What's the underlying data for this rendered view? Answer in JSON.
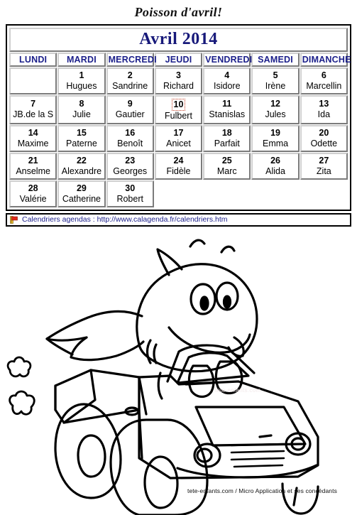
{
  "page": {
    "heading": "Poisson d'avril!"
  },
  "calendar": {
    "month_title": "Avril 2014",
    "weekdays": [
      "LUNDI",
      "MARDI",
      "MERCREDI",
      "JEUDI",
      "VENDREDI",
      "SAMEDI",
      "DIMANCHE"
    ],
    "selected_day": "10",
    "weeks": [
      [
        {
          "num": "",
          "name": ""
        },
        {
          "num": "1",
          "name": "Hugues"
        },
        {
          "num": "2",
          "name": "Sandrine"
        },
        {
          "num": "3",
          "name": "Richard"
        },
        {
          "num": "4",
          "name": "Isidore"
        },
        {
          "num": "5",
          "name": "Irène"
        },
        {
          "num": "6",
          "name": "Marcellin"
        }
      ],
      [
        {
          "num": "7",
          "name": "JB.de la S"
        },
        {
          "num": "8",
          "name": "Julie"
        },
        {
          "num": "9",
          "name": "Gautier"
        },
        {
          "num": "10",
          "name": "Fulbert"
        },
        {
          "num": "11",
          "name": "Stanislas"
        },
        {
          "num": "12",
          "name": "Jules"
        },
        {
          "num": "13",
          "name": "Ida"
        }
      ],
      [
        {
          "num": "14",
          "name": "Maxime"
        },
        {
          "num": "15",
          "name": "Paterne"
        },
        {
          "num": "16",
          "name": "Benoît"
        },
        {
          "num": "17",
          "name": "Anicet"
        },
        {
          "num": "18",
          "name": "Parfait"
        },
        {
          "num": "19",
          "name": "Emma"
        },
        {
          "num": "20",
          "name": "Odette"
        }
      ],
      [
        {
          "num": "21",
          "name": "Anselme"
        },
        {
          "num": "22",
          "name": "Alexandre"
        },
        {
          "num": "23",
          "name": "Georges"
        },
        {
          "num": "24",
          "name": "Fidèle"
        },
        {
          "num": "25",
          "name": "Marc"
        },
        {
          "num": "26",
          "name": "Alida"
        },
        {
          "num": "27",
          "name": "Zita"
        }
      ],
      [
        {
          "num": "28",
          "name": "Valérie"
        },
        {
          "num": "29",
          "name": "Catherine"
        },
        {
          "num": "30",
          "name": "Robert"
        },
        {
          "num": "",
          "name": ""
        },
        {
          "num": "",
          "name": ""
        },
        {
          "num": "",
          "name": ""
        },
        {
          "num": "",
          "name": ""
        }
      ]
    ]
  },
  "footer": {
    "icon": "flag-icon",
    "text": "Calendriers agendas : http://www.calagenda.fr/calendriers.htm"
  },
  "illustration": {
    "alt_name": "fish-driving-car-coloring-page",
    "watermark": "tete-enfants.com",
    "credit": "tete-enfants.com / Micro Application et ses concédants"
  },
  "colors": {
    "title_blue": "#17197a",
    "weekday_blue": "#1b1f8a",
    "selection_red": "#c23b22",
    "line_black": "#000000",
    "page_bg": "#ffffff"
  }
}
